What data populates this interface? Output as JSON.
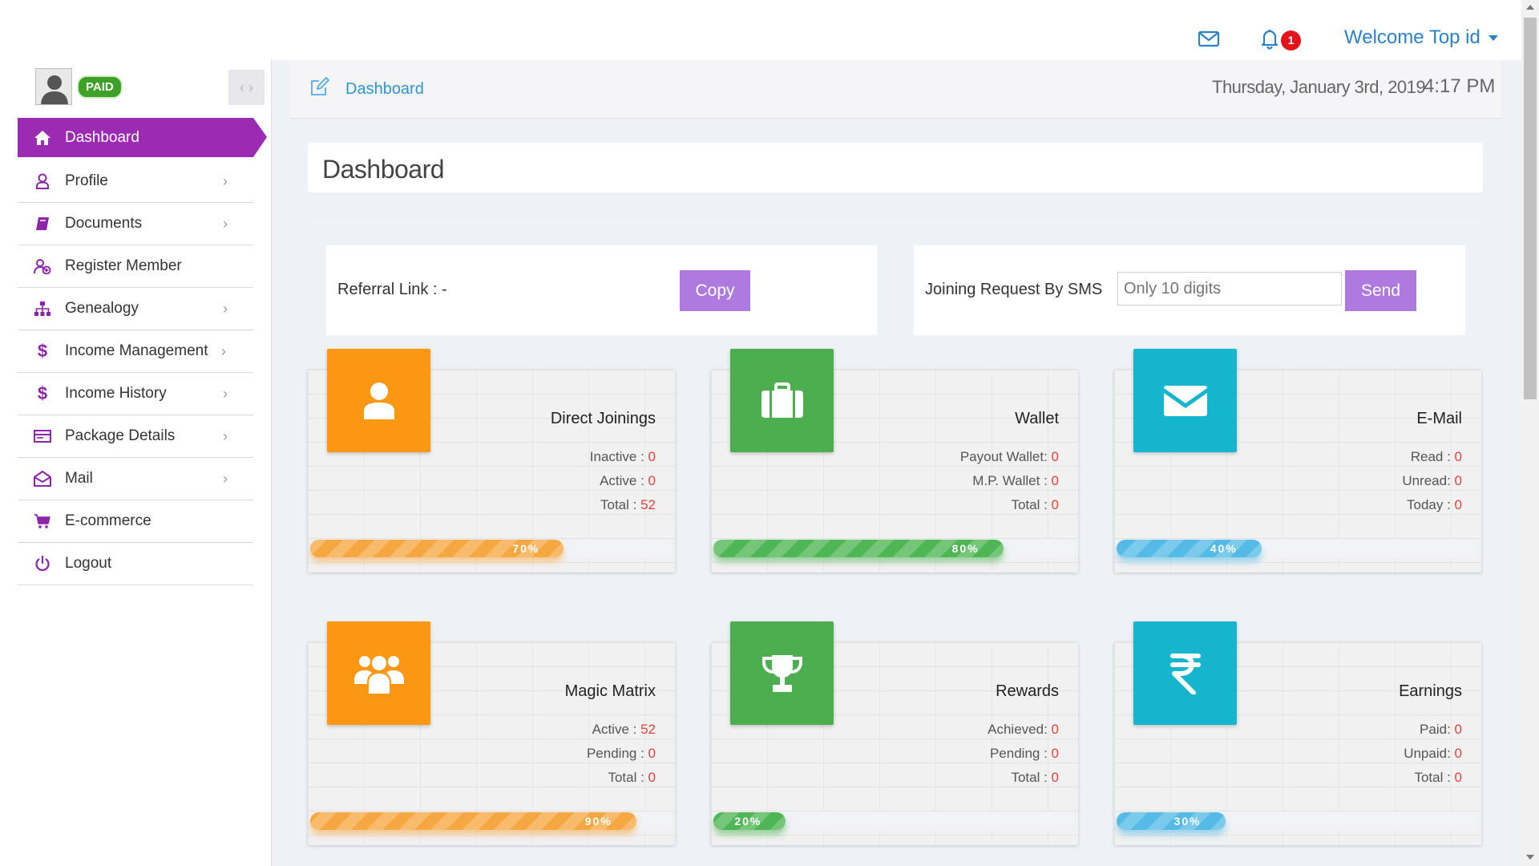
{
  "header": {
    "welcome": "Welcome Top id",
    "notification_count": "1"
  },
  "sidebar": {
    "status_badge": "PAID",
    "items": [
      {
        "label": "Dashboard",
        "icon": "home-icon"
      },
      {
        "label": "Profile",
        "icon": "user-icon"
      },
      {
        "label": "Documents",
        "icon": "book-icon"
      },
      {
        "label": "Register Member",
        "icon": "user-add-icon"
      },
      {
        "label": "Genealogy",
        "icon": "sitemap-icon"
      },
      {
        "label": "Income Management",
        "icon": "dollar-icon"
      },
      {
        "label": "Income History",
        "icon": "dollar-icon"
      },
      {
        "label": "Package Details",
        "icon": "package-icon"
      },
      {
        "label": "Mail",
        "icon": "envelope-open-icon"
      },
      {
        "label": "E-commerce",
        "icon": "cart-icon"
      },
      {
        "label": "Logout",
        "icon": "power-icon"
      }
    ]
  },
  "breadcrumb": {
    "label": "Dashboard",
    "date": "Thursday, January 3rd, 2019",
    "time": "4:17 PM"
  },
  "page_title": "Dashboard",
  "referral": {
    "label": "Referral Link : -",
    "copy_label": "Copy"
  },
  "sms": {
    "label": "Joining Request By SMS",
    "placeholder": "Only 10 digits",
    "send_label": "Send"
  },
  "cards": [
    {
      "title": "Direct Joinings",
      "icon": "user-icon",
      "color": "#fb9712",
      "rows": [
        {
          "label": "Inactive : ",
          "value": "0"
        },
        {
          "label": "Active : ",
          "value": "0"
        },
        {
          "label": "Total : ",
          "value": "52"
        }
      ],
      "progress_label": "70%",
      "progress": 0.7
    },
    {
      "title": "Wallet",
      "icon": "briefcase-icon",
      "color": "#4cae4f",
      "rows": [
        {
          "label": "Payout Wallet: ",
          "value": "0"
        },
        {
          "label": "M.P. Wallet : ",
          "value": "0"
        },
        {
          "label": "Total : ",
          "value": "0"
        }
      ],
      "progress_label": "80%",
      "progress": 0.8
    },
    {
      "title": "E-Mail",
      "icon": "envelope-icon",
      "color": "#15b5ce",
      "rows": [
        {
          "label": "Read : ",
          "value": "0"
        },
        {
          "label": "Unread: ",
          "value": "0"
        },
        {
          "label": "Today : ",
          "value": "0"
        }
      ],
      "progress_label": "40%",
      "progress": 0.4
    },
    {
      "title": "Magic Matrix",
      "icon": "users-icon",
      "color": "#fb9712",
      "rows": [
        {
          "label": "Active : ",
          "value": "52"
        },
        {
          "label": "Pending : ",
          "value": "0"
        },
        {
          "label": "Total : ",
          "value": "0"
        }
      ],
      "progress_label": "90%",
      "progress": 0.9
    },
    {
      "title": "Rewards",
      "icon": "trophy-icon",
      "color": "#4cae4f",
      "rows": [
        {
          "label": "Achieved: ",
          "value": "0"
        },
        {
          "label": "Pending : ",
          "value": "0"
        },
        {
          "label": "Total : ",
          "value": "0"
        }
      ],
      "progress_label": "20%",
      "progress": 0.2
    },
    {
      "title": "Earnings",
      "icon": "rupee-icon",
      "color": "#15b5ce",
      "rows": [
        {
          "label": "Paid: ",
          "value": "0"
        },
        {
          "label": "Unpaid: ",
          "value": "0"
        },
        {
          "label": "Total : ",
          "value": "0"
        }
      ],
      "progress_label": "30%",
      "progress": 0.3
    }
  ]
}
